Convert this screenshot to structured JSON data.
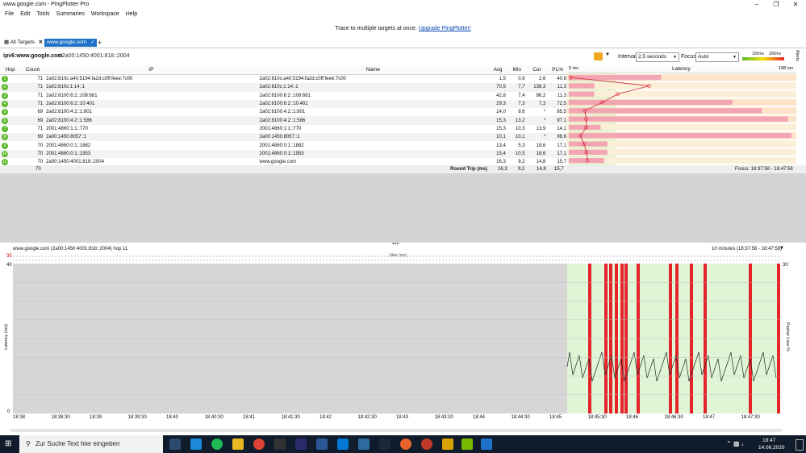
{
  "window": {
    "title": "www.google.com - PingPlotter Pro"
  },
  "menu": [
    "File",
    "Edit",
    "Tools",
    "Summaries",
    "Workspace",
    "Help"
  ],
  "promo": {
    "text": "Trace to multiple targets at once.",
    "link": "Upgrade PingPlotter!"
  },
  "tabs": {
    "all_targets": "All Targets",
    "active": "www.google.com",
    "add": "+"
  },
  "target": {
    "label": "ipv6:www.google.com",
    "address": "/ 2a00:1450:4001:818::2004"
  },
  "controls": {
    "interval_label": "Interval",
    "interval_value": "2,5 seconds",
    "focus_label": "Focus",
    "focus_value": "Auto",
    "scale_100": "100ms",
    "scale_200": "200ms",
    "alerts": "Alerts"
  },
  "columns": {
    "hop": "Hop",
    "count": "Count",
    "ip": "IP",
    "name": "Name",
    "avg": "Avg",
    "min": "Min",
    "cur": "Cur",
    "pl": "PL%",
    "zero_ms": "0 ms",
    "latency": "Latency",
    "max_ms": "198 ms"
  },
  "hops": [
    {
      "hop": "1",
      "count": "71",
      "ip": "2a02:810c:a40:5194:fa2d:c0ff:feee:7c00",
      "name": "2a02:810c:a40:5194:fa2d:c0ff:feee:7c00",
      "avg": "1,5",
      "min": "0,9",
      "cur": "2,6",
      "pl": "40,8"
    },
    {
      "hop": "2",
      "count": "71",
      "ip": "2a02:810c:1:14::1",
      "name": "2a02:810c:1:14::1",
      "avg": "70,5",
      "min": "7,7",
      "cur": "138,3",
      "pl": "11,3"
    },
    {
      "hop": "3",
      "count": "71",
      "ip": "2a02:8100:6:2::108:681",
      "name": "2a02:8100:6:2::108:681",
      "avg": "42,8",
      "min": "7,4",
      "cur": "86,2",
      "pl": "11,3"
    },
    {
      "hop": "4",
      "count": "71",
      "ip": "2a02:8100:6:2::10:401",
      "name": "2a02:8100:6:2::10:401",
      "avg": "29,3",
      "min": "7,3",
      "cur": "7,3",
      "pl": "72,5"
    },
    {
      "hop": "5",
      "count": "69",
      "ip": "2a02:8100:4:2::1:801",
      "name": "2a02:8100:4:2::1:801",
      "avg": "14,0",
      "min": "9,6",
      "cur": "*",
      "pl": "85,5"
    },
    {
      "hop": "6",
      "count": "69",
      "ip": "2a02:8100:4:2::1:586",
      "name": "2a02:8100:4:2::1:586",
      "avg": "15,3",
      "min": "13,2",
      "cur": "*",
      "pl": "97,1"
    },
    {
      "hop": "7",
      "count": "71",
      "ip": "2001:4860:1:1::770",
      "name": "2001:4860:1:1::770",
      "avg": "15,3",
      "min": "10,3",
      "cur": "13,9",
      "pl": "14,1"
    },
    {
      "hop": "8",
      "count": "69",
      "ip": "2a00:1450:8057::1",
      "name": "2a00:1450:8057::1",
      "avg": "10,1",
      "min": "10,1",
      "cur": "*",
      "pl": "98,6"
    },
    {
      "hop": "9",
      "count": "70",
      "ip": "2001:4860:0:1::1882",
      "name": "2001:4860:0:1::1882",
      "avg": "13,4",
      "min": "5,3",
      "cur": "18,6",
      "pl": "17,1"
    },
    {
      "hop": "10",
      "count": "70",
      "ip": "2001:4860:0:1::1953",
      "name": "2001:4860:0:1::1953",
      "avg": "15,4",
      "min": "10,5",
      "cur": "18,6",
      "pl": "17,1"
    },
    {
      "hop": "11",
      "count": "70",
      "ip": "2a00:1450:4001:818::2004",
      "name": "www.google.com",
      "avg": "16,3",
      "min": "9,2",
      "cur": "14,8",
      "pl": "15,7"
    }
  ],
  "summary": {
    "count": "70",
    "label": "Round Trip (ms)",
    "avg": "16,3",
    "min": "9,2",
    "cur": "14,8",
    "pl": "15,7",
    "focus": "Focus: 18:37:58 - 18:47:58"
  },
  "graph": {
    "title": "www.google.com (2a00:1450:4001:818::2004) hop 11",
    "range": "10 minutes (18:37:58 - 18:47:58)",
    "jitter_label": "Jitter (ms)",
    "jitter_max": "35",
    "y_top": "40",
    "y_bottom": "0",
    "pl_top": "30",
    "ylabel": "Latency (ms)",
    "y2label": "Packet Loss %",
    "time_labels": [
      "18:38",
      "18:38:30",
      "18:39",
      "18:39:30",
      "18:40",
      "18:40:30",
      "18:41",
      "18:41:30",
      "18:42",
      "18:42:30",
      "18:43",
      "18:43:30",
      "18:44",
      "18:44:30",
      "18:45",
      "18:45:30",
      "18:46",
      "18:46:30",
      "18:47",
      "18:47:30"
    ]
  },
  "taskbar": {
    "search_placeholder": "Zur Suche Text hier eingeben",
    "time": "18:47",
    "date": "14.06.2020"
  },
  "colors": {
    "accent": "#1e72c8",
    "hop_ok": "#5cb82a",
    "loss_bar": "#e3242b",
    "good_zone": "#dff5d5",
    "latency_bar": "#f2a5b2"
  }
}
